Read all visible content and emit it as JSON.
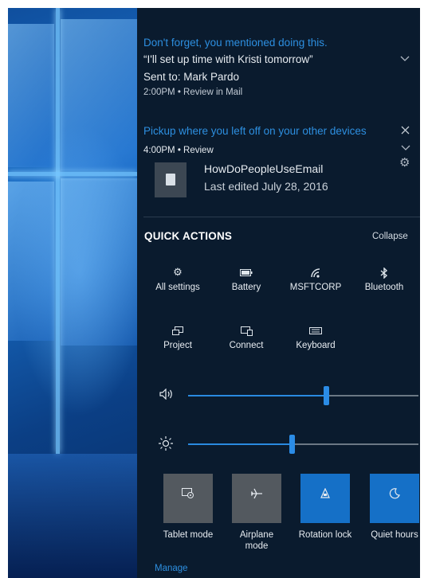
{
  "notification_1": {
    "title": "Don't forget, you mentioned doing this.",
    "quote": "“I'll set up time with Kristi tomorrow”",
    "sent_to": "Sent to: Mark Pardo",
    "meta": "2:00PM  •  Review in Mail",
    "expand_icon": "chevron-down-icon"
  },
  "notification_2": {
    "title": "Pickup where you left off on your other devices",
    "time": "4:00PM  •  Review",
    "file_name": "HowDoPeopleUseEmail",
    "edited": "Last edited July 28, 2016",
    "close_icon": "close-icon",
    "expand_icon": "chevron-down-icon",
    "settings_icon": "gear-icon",
    "file_icon": "document-icon"
  },
  "quick_actions": {
    "title": "QUICK ACTIONS",
    "collapse": "Collapse",
    "items": [
      {
        "label": "All settings",
        "icon": "gear-icon"
      },
      {
        "label": "Battery",
        "icon": "battery-icon"
      },
      {
        "label": "MSFTCORP",
        "icon": "wifi-icon"
      },
      {
        "label": "Bluetooth",
        "icon": "bluetooth-icon"
      },
      {
        "label": "Project",
        "icon": "project-icon"
      },
      {
        "label": "Connect",
        "icon": "connect-icon"
      },
      {
        "label": "Keyboard",
        "icon": "keyboard-icon"
      }
    ]
  },
  "sliders": {
    "volume": {
      "icon": "speaker-icon",
      "level": 0.6
    },
    "brightness": {
      "icon": "sun-icon",
      "level": 0.45
    }
  },
  "tiles": [
    {
      "label": "Tablet mode",
      "icon": "tablet-mode-icon",
      "active": false
    },
    {
      "label": "Airplane\nmode",
      "label_line1": "Airplane",
      "label_line2": "mode",
      "icon": "airplane-icon",
      "active": false
    },
    {
      "label": "Rotation lock",
      "icon": "rotation-lock-icon",
      "active": true
    },
    {
      "label": "Quiet hours",
      "icon": "moon-icon",
      "active": true
    }
  ],
  "manage": "Manage",
  "colors": {
    "accent": "#2d8fe0",
    "panel_bg": "#0a1b2e",
    "tile_active": "#1570c7",
    "tile_inactive": "#53595f"
  }
}
